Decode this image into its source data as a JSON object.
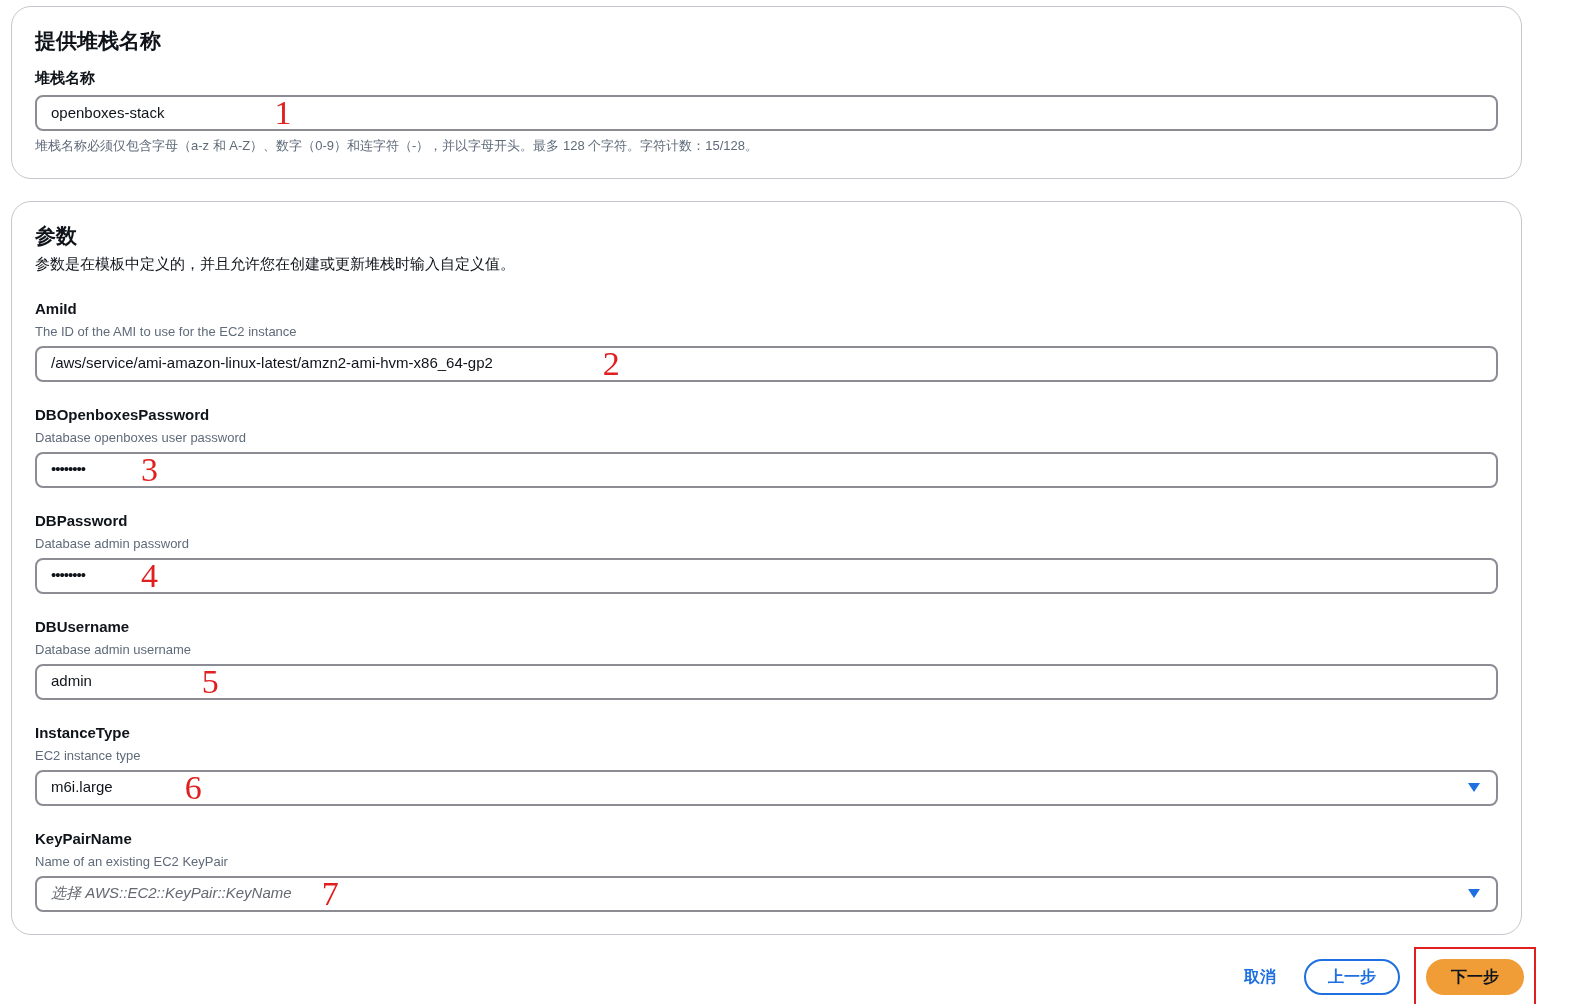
{
  "stack_section": {
    "title": "提供堆栈名称",
    "field": {
      "label": "堆栈名称",
      "value": "openboxes-stack",
      "marker": "1"
    },
    "hint": "堆栈名称必须仅包含字母（a-z 和 A-Z）、数字（0-9）和连字符（-），并以字母开头。最多 128 个字符。字符计数：15/128。"
  },
  "parameters_section": {
    "title": "参数",
    "description": "参数是在模板中定义的，并且允许您在创建或更新堆栈时输入自定义值。",
    "fields": [
      {
        "kind": "text",
        "label": "AmiId",
        "description": "The ID of the AMI to use for the EC2 instance",
        "value": "/aws/service/ami-amazon-linux-latest/amzn2-ami-hvm-x86_64-gp2",
        "marker": "2"
      },
      {
        "kind": "password",
        "label": "DBOpenboxesPassword",
        "description": "Database openboxes user password",
        "value": "••••••••",
        "marker": "3"
      },
      {
        "kind": "password",
        "label": "DBPassword",
        "description": "Database admin password",
        "value": "••••••••",
        "marker": "4"
      },
      {
        "kind": "text",
        "label": "DBUsername",
        "description": "Database admin username",
        "value": "admin",
        "marker": "5"
      },
      {
        "kind": "select",
        "label": "InstanceType",
        "description": "EC2 instance type",
        "value": "m6i.large",
        "marker": "6"
      },
      {
        "kind": "select",
        "label": "KeyPairName",
        "description": "Name of an existing EC2 KeyPair",
        "placeholder": "选择 AWS::EC2::KeyPair::KeyName",
        "marker": "7"
      }
    ]
  },
  "footer": {
    "cancel": "取消",
    "previous": "上一步",
    "next": "下一步",
    "next_highlighted": true
  }
}
